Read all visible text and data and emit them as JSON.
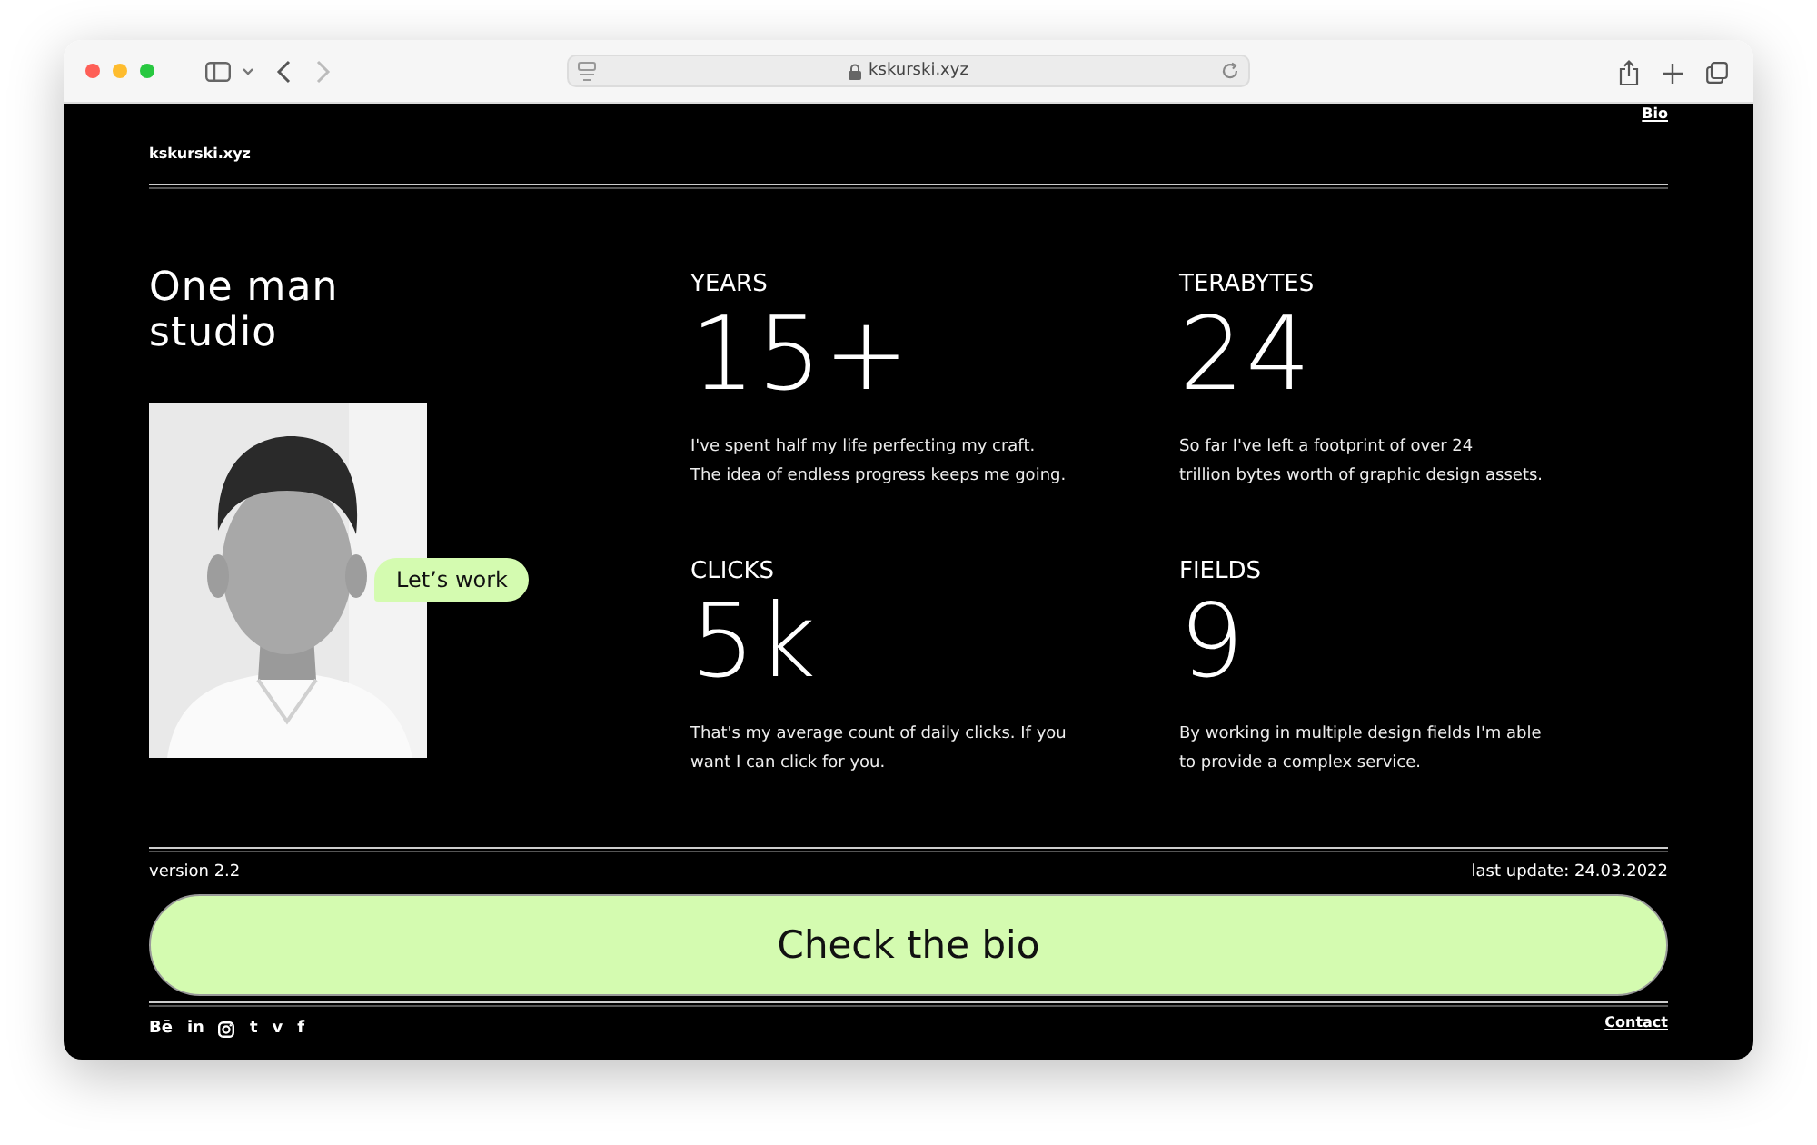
{
  "browser": {
    "url": "kskurski.xyz"
  },
  "header": {
    "site": "kskurski.xyz",
    "nav_link": "Bio"
  },
  "hero": {
    "title_lines": [
      "One man",
      "studio"
    ],
    "chat_bubble": "Let’s work"
  },
  "stats": [
    {
      "label": "YEARS",
      "value": "15+",
      "text_lines": [
        "I've spent half my life perfecting my craft.",
        "The idea of endless progress keeps me going."
      ]
    },
    {
      "label": "TERABYTES",
      "value": "24",
      "text_lines": [
        "So far I've left a footprint of over 24",
        "trillion bytes worth of graphic design assets."
      ]
    },
    {
      "label": "CLICKS",
      "value": "5k",
      "text_lines": [
        "That's my average count of daily clicks. If you",
        "want I can click for you."
      ]
    },
    {
      "label": "FIELDS",
      "value": "9",
      "text_lines": [
        "By working in multiple design fields I'm able",
        "to provide a complex service."
      ]
    }
  ],
  "footer": {
    "version": "version 2.2",
    "last_update": "last update: 24.03.2022",
    "cta": "Check the bio",
    "contact": "Contact",
    "socials": [
      {
        "kind": "glyph",
        "text": "Bē"
      },
      {
        "kind": "glyph",
        "text": "in"
      },
      {
        "kind": "instagram"
      },
      {
        "kind": "glyph",
        "text": "t"
      },
      {
        "kind": "glyph",
        "text": "v"
      },
      {
        "kind": "glyph",
        "text": "f"
      }
    ]
  }
}
